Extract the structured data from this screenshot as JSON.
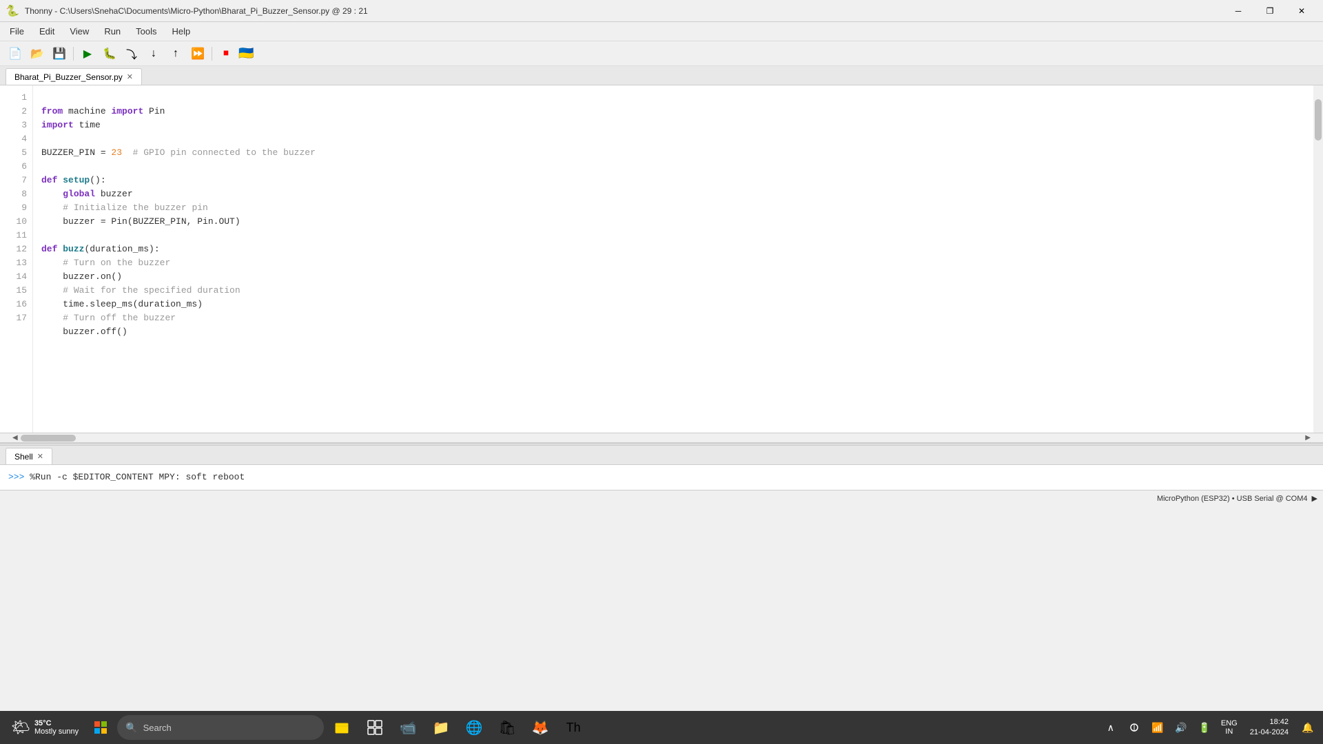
{
  "titlebar": {
    "app_name": "Thonny",
    "file_path": "C:\\Users\\SnehaC\\Documents\\Micro-Python\\Bharat_Pi_Buzzer_Sensor.py @ 29 : 21",
    "full_title": "Thonny - C:\\Users\\SnehaC\\Documents\\Micro-Python\\Bharat_Pi_Buzzer_Sensor.py @ 29 : 21"
  },
  "menu": {
    "items": [
      "File",
      "Edit",
      "View",
      "Run",
      "Tools",
      "Help"
    ]
  },
  "toolbar": {
    "buttons": [
      "new",
      "open",
      "save",
      "run",
      "debug",
      "step_over",
      "step_into",
      "step_out",
      "stop",
      "flag"
    ]
  },
  "tab": {
    "label": "Bharat_Pi_Buzzer_Sensor.py"
  },
  "code": {
    "lines": [
      {
        "num": 1,
        "content": "from machine import Pin"
      },
      {
        "num": 2,
        "content": "import time"
      },
      {
        "num": 3,
        "content": ""
      },
      {
        "num": 4,
        "content": "BUZZER_PIN = 23  # GPIO pin connected to the buzzer"
      },
      {
        "num": 5,
        "content": ""
      },
      {
        "num": 6,
        "content": "def setup():"
      },
      {
        "num": 7,
        "content": "    global buzzer"
      },
      {
        "num": 8,
        "content": "    # Initialize the buzzer pin"
      },
      {
        "num": 9,
        "content": "    buzzer = Pin(BUZZER_PIN, Pin.OUT)"
      },
      {
        "num": 10,
        "content": ""
      },
      {
        "num": 11,
        "content": "def buzz(duration_ms):"
      },
      {
        "num": 12,
        "content": "    # Turn on the buzzer"
      },
      {
        "num": 13,
        "content": "    buzzer.on()"
      },
      {
        "num": 14,
        "content": "    # Wait for the specified duration"
      },
      {
        "num": 15,
        "content": "    time.sleep_ms(duration_ms)"
      },
      {
        "num": 16,
        "content": "    # Turn off the buzzer"
      },
      {
        "num": 17,
        "content": "    buzzer.off()"
      }
    ]
  },
  "shell": {
    "tab_label": "Shell",
    "prompt": ">>>",
    "command": " %Run -c $EDITOR_CONTENT",
    "output": "MPY: soft reboot"
  },
  "status_bar": {
    "connection": "MicroPython (ESP32) • USB Serial @ COM4"
  },
  "taskbar": {
    "weather": {
      "temp": "35°C",
      "condition": "Mostly sunny"
    },
    "search_placeholder": "Search",
    "clock": {
      "time": "18:42",
      "date": "21-04-2024"
    },
    "lang": "ENG",
    "lang2": "IN"
  }
}
